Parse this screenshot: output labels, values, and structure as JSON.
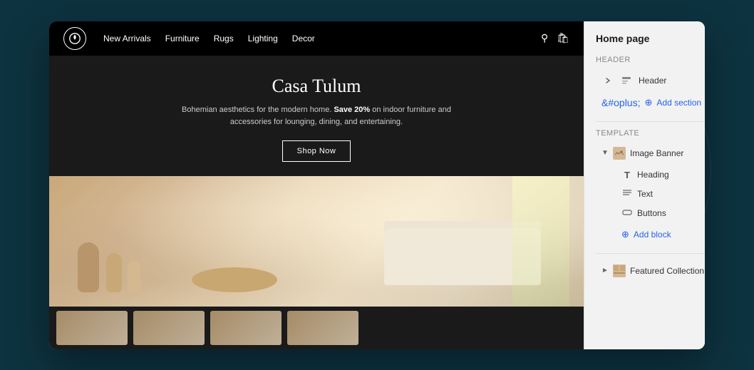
{
  "background": {
    "color": "#0d3340"
  },
  "nav": {
    "logo_aria": "Casa Tulum logo",
    "links": [
      {
        "label": "New Arrivals",
        "id": "nav-new-arrivals"
      },
      {
        "label": "Furniture",
        "id": "nav-furniture"
      },
      {
        "label": "Rugs",
        "id": "nav-rugs"
      },
      {
        "label": "Lighting",
        "id": "nav-lighting"
      },
      {
        "label": "Decor",
        "id": "nav-decor"
      }
    ]
  },
  "hero": {
    "title": "Casa Tulum",
    "subtitle_before_bold": "Bohemian aesthetics for the modern home. ",
    "subtitle_bold": "Save 20%",
    "subtitle_after_bold": " on indoor furniture and accessories for lounging, dining, and entertaining.",
    "cta_label": "Shop Now"
  },
  "panel": {
    "title": "Home page",
    "header_section_label": "Header",
    "header_item_label": "Header",
    "add_section_label": "Add section",
    "template_section_label": "Template",
    "image_banner_label": "Image Banner",
    "heading_label": "Heading",
    "text_label": "Text",
    "buttons_label": "Buttons",
    "add_block_label": "Add block",
    "featured_collection_label": "Featured Collection"
  },
  "thumbnails": [
    {
      "id": "thumb-1"
    },
    {
      "id": "thumb-2"
    },
    {
      "id": "thumb-3"
    },
    {
      "id": "thumb-4"
    }
  ]
}
